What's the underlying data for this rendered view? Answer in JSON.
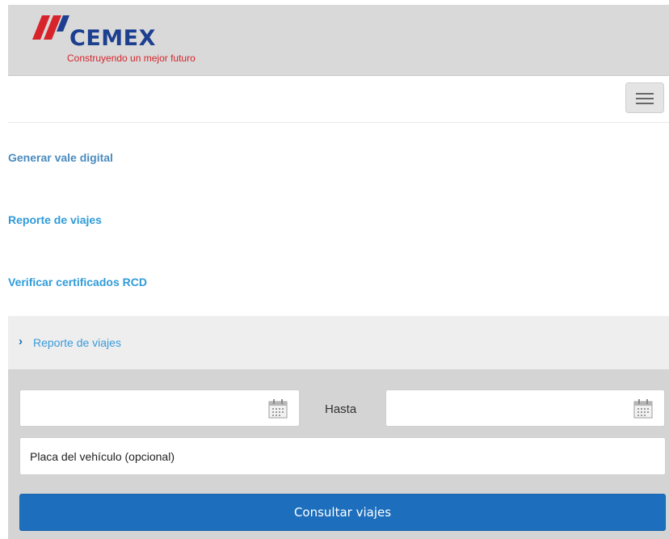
{
  "header": {
    "logo_text": "CEMEX",
    "tagline": "Construyendo un mejor futuro"
  },
  "nav": {
    "menu_icon": "hamburger-menu-icon",
    "links": [
      {
        "label": "Generar vale digital"
      },
      {
        "label": "Reporte de viajes"
      },
      {
        "label": "Verificar certificados RCD"
      }
    ]
  },
  "breadcrumb": {
    "icon": "chevron-right-icon",
    "current": "Reporte de viajes"
  },
  "form": {
    "date_icon": "calendar-icon",
    "date_from_value": "",
    "hasta_label": "Hasta",
    "date_to_value": "",
    "plate_placeholder": "Placa del vehículo (opcional)",
    "submit_label": "Consultar viajes"
  },
  "colors": {
    "brand_blue": "#1d3f8f",
    "brand_red": "#d7242b",
    "link_blue": "#2f9bd8",
    "button_blue": "#1d6fbd"
  }
}
